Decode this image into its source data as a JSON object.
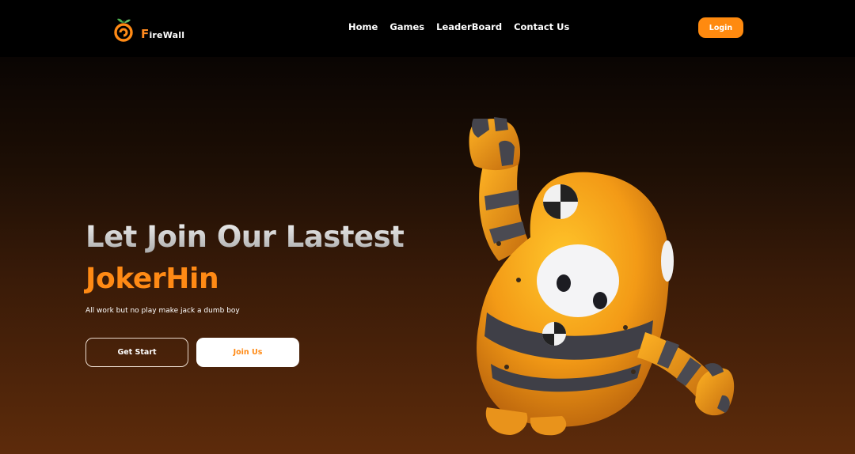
{
  "brand": {
    "first_letter": "F",
    "rest": "ireWall",
    "logo_icon": "orange-fruit-icon",
    "accent_color": "#ff8a15"
  },
  "nav": {
    "items": [
      {
        "label": "Home"
      },
      {
        "label": "Games"
      },
      {
        "label": "LeaderBoard"
      },
      {
        "label": "Contact Us"
      }
    ],
    "login_label": "Login"
  },
  "hero": {
    "title": "Let Join Our Lastest",
    "name": "JokerHin",
    "subtitle": "All work but no play make jack a dumb boy",
    "primary_button": "Get Start",
    "secondary_button": "Join Us",
    "illustration": "orange-crash-test-character"
  }
}
